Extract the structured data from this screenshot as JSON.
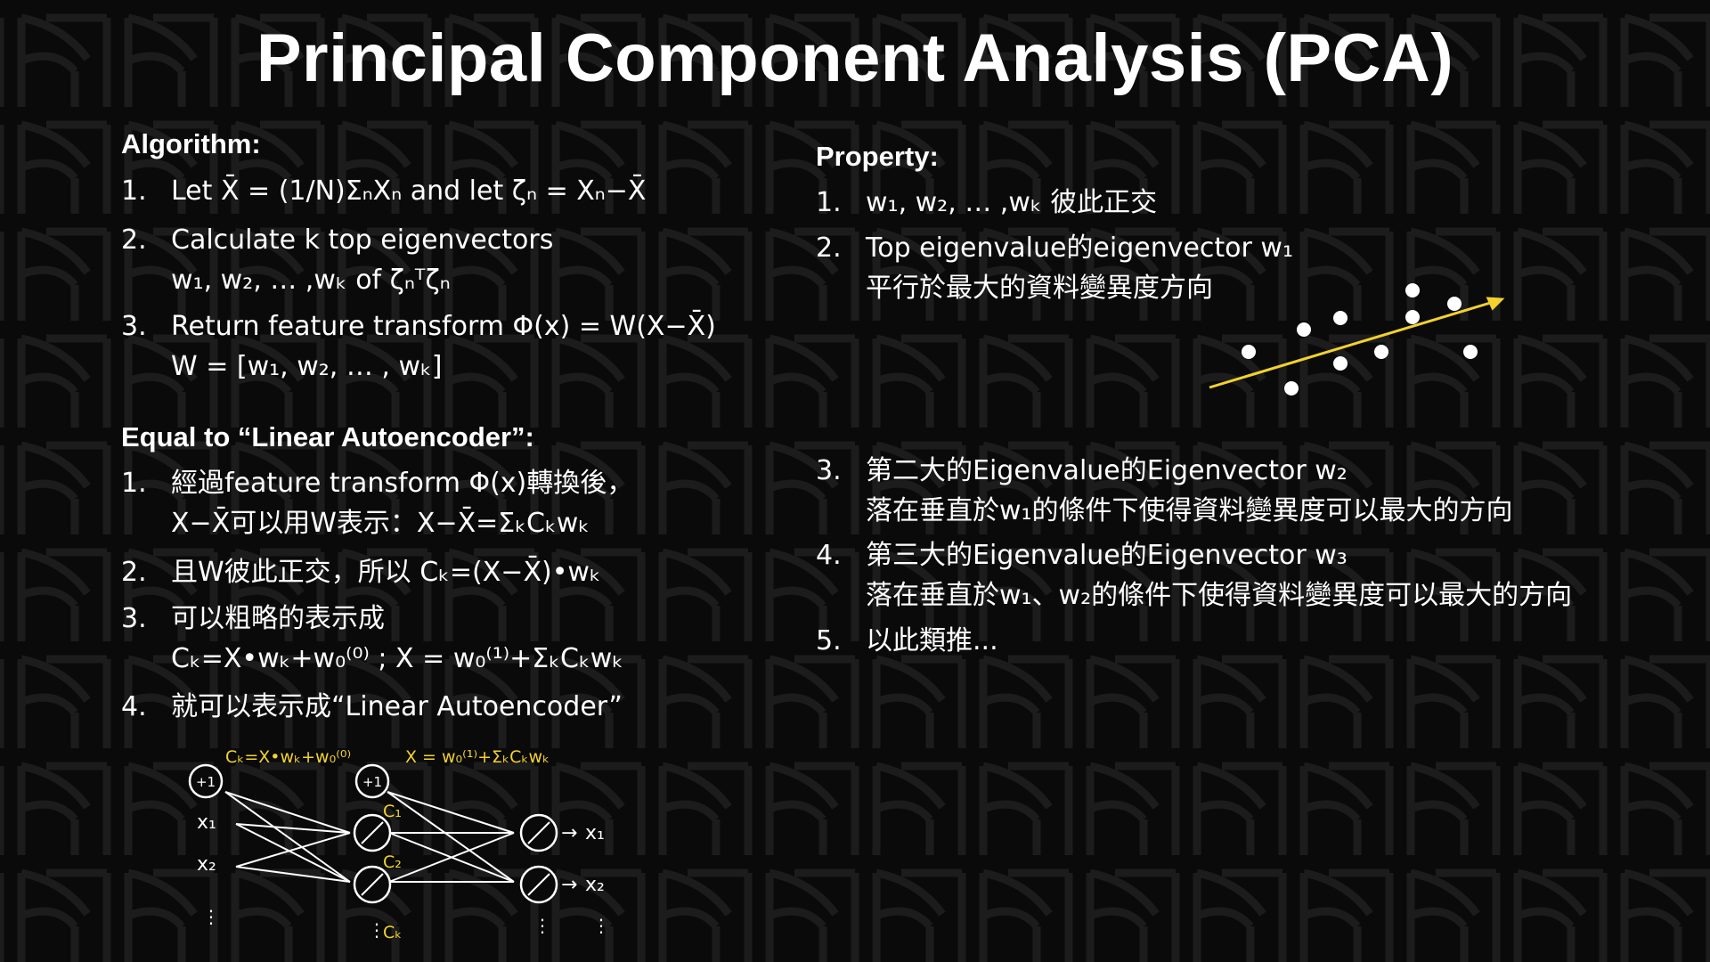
{
  "title": "Principal Component Analysis (PCA)",
  "algorithm": {
    "heading": "Algorithm:",
    "items": [
      {
        "num": "1.",
        "lines": [
          "Let X̄ = (1/N)ΣₙXₙ and let ζₙ = Xₙ−X̄"
        ]
      },
      {
        "num": "2.",
        "lines": [
          "Calculate k top eigenvectors",
          "w₁, w₂, … ,wₖ of ζₙᵀζₙ"
        ]
      },
      {
        "num": "3.",
        "lines": [
          "Return feature transform Φ(x) = W(X−X̄)",
          "W = [w₁, w₂, … , wₖ]"
        ]
      }
    ]
  },
  "autoencoder": {
    "heading": "Equal to “Linear Autoencoder”:",
    "items": [
      {
        "num": "1.",
        "lines": [
          "經過feature transform Φ(x)轉換後，",
          "X−X̄可以用W表示：X−X̄=ΣₖCₖwₖ"
        ]
      },
      {
        "num": "2.",
        "lines": [
          "且W彼此正交，所以 Cₖ=(X−X̄)•wₖ"
        ]
      },
      {
        "num": "3.",
        "lines": [
          "可以粗略的表示成",
          "Cₖ=X•wₖ+w₀⁽⁰⁾ ; X = w₀⁽¹⁾+ΣₖCₖwₖ"
        ]
      },
      {
        "num": "4.",
        "lines": [
          "就可以表示成“Linear Autoencoder”"
        ]
      }
    ]
  },
  "property": {
    "heading": "Property:",
    "items": [
      {
        "num": "1.",
        "lines": [
          "w₁, w₂, … ,wₖ 彼此正交"
        ]
      },
      {
        "num": "2.",
        "lines": [
          "Top eigenvalue的eigenvector w₁",
          "平行於最大的資料變異度方向"
        ]
      },
      {
        "num": "3.",
        "lines": [
          "第二大的Eigenvalue的Eigenvector w₂",
          "落在垂直於w₁的條件下使得資料變異度可以最大的方向"
        ]
      },
      {
        "num": "4.",
        "lines": [
          "第三大的Eigenvalue的Eigenvector w₃",
          "落在垂直於w₁、w₂的條件下使得資料變異度可以最大的方向"
        ]
      },
      {
        "num": "5.",
        "lines": [
          "以此類推..."
        ]
      }
    ]
  },
  "network": {
    "encoder_eq": "Cₖ=X•wₖ+w₀⁽⁰⁾",
    "decoder_eq": "X = w₀⁽¹⁾+ΣₖCₖwₖ",
    "bias": "+1",
    "inputs": [
      "x₁",
      "x₂"
    ],
    "hidden": [
      "C₁",
      "C₂",
      "Cₖ"
    ],
    "outputs": [
      "x₁",
      "x₂"
    ],
    "ellipsis": "⋮",
    "arrow": "→"
  },
  "colors": {
    "accent": "#f2d22e",
    "text": "#ffffff",
    "background": "#0a0a0a",
    "pattern": "#1c1c1c"
  }
}
